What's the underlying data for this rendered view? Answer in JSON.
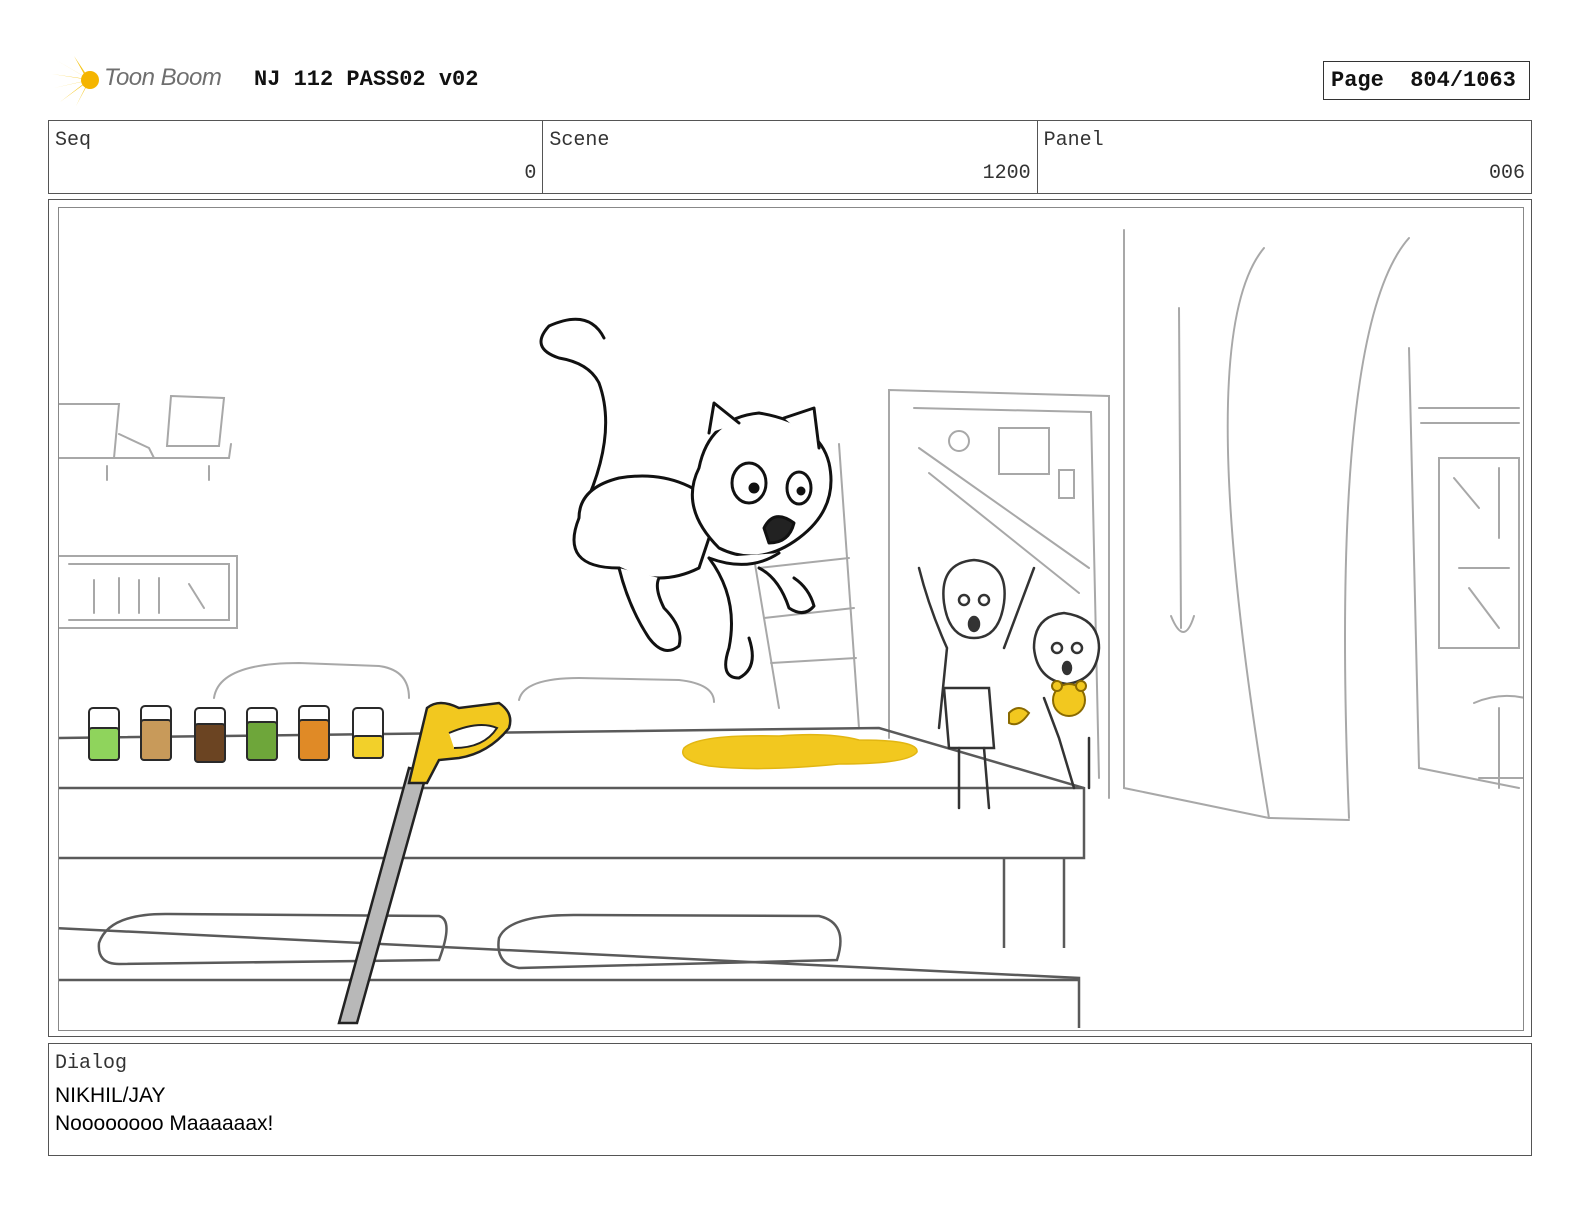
{
  "header": {
    "logo_text": "Toon Boom",
    "title": "NJ 112 PASS02 v02",
    "page_label": "Page",
    "page_value": "804/1063"
  },
  "info": {
    "seq_label": "Seq",
    "seq_value": "0",
    "scene_label": "Scene",
    "scene_value": "1200",
    "panel_label": "Panel",
    "panel_value": "006"
  },
  "drawing": {
    "description_icon": "storyboard-sketch",
    "colors": {
      "line": "#1a1a1a",
      "background_line": "#9a9a9a",
      "spill": "#f2c81f",
      "jar_green": "#8fd45c",
      "jar_tan": "#c89a5a",
      "jar_brown": "#6b4422",
      "jar_dark_green": "#6ea63a",
      "jar_orange": "#e08a26",
      "jar_yellow": "#f2d02a"
    }
  },
  "dialog": {
    "label": "Dialog",
    "speaker": "NIKHIL/JAY",
    "line": "Noooooooo Maaaaaax!"
  }
}
